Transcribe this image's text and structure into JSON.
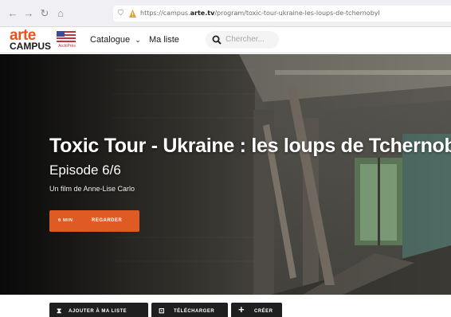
{
  "browser": {
    "url_prefix": "https://campus.",
    "url_domain": "arte.tv",
    "url_path": "/program/toxic-tour-ukraine-les-loups-de-tchernobyl"
  },
  "header": {
    "logo_top": "arte",
    "logo_bottom": "CAMPUS",
    "flag_caption": "ArchiPrès",
    "nav": {
      "catalogue": "Catalogue",
      "ma_liste": "Ma liste"
    },
    "search": {
      "placeholder": "Chercher..."
    }
  },
  "hero": {
    "title": "Toxic Tour - Ukraine : les loups de Tchernobyl",
    "subtitle": "Episode 6/6",
    "credit": "Un film de Anne-Lise Carlo",
    "watch": {
      "duration": "6 MIN",
      "label": "REGARDER"
    }
  },
  "actions": {
    "add_to_list": "AJOUTER À MA LISTE",
    "download": "TÉLÉCHARGER",
    "create": "CRÉER"
  },
  "colors": {
    "accent": "#e05a24",
    "dark_button": "#1f1f1f"
  }
}
